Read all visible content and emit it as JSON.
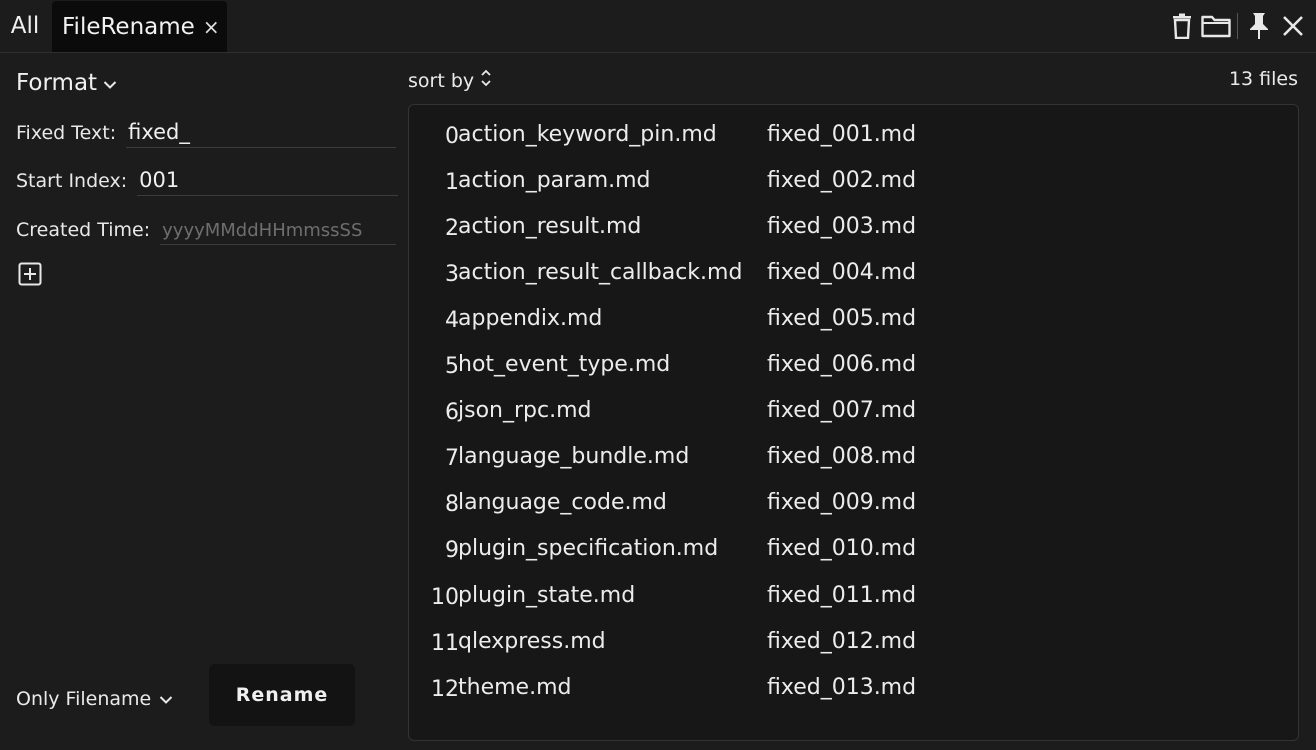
{
  "tabs": {
    "all_label": "All",
    "active_label": "FileRename",
    "close_glyph": "×"
  },
  "toolbar": {
    "icons": [
      "trash-icon",
      "folder-icon",
      "pin-icon",
      "close-icon"
    ]
  },
  "format": {
    "label": "Format",
    "fixed_text_label": "Fixed Text:",
    "fixed_text_value": "fixed_",
    "start_index_label": "Start Index:",
    "start_index_value": "001",
    "created_time_label": "Created Time:",
    "created_time_placeholder": "yyyyMMddHHmmssSS"
  },
  "footer": {
    "mode_label": "Only Filename",
    "rename_label": "Rename"
  },
  "list": {
    "sort_label": "sort by",
    "count_label": "13 files",
    "rows": [
      {
        "index": "0",
        "original": "action_keyword_pin.md",
        "renamed": "fixed_001.md"
      },
      {
        "index": "1",
        "original": "action_param.md",
        "renamed": "fixed_002.md"
      },
      {
        "index": "2",
        "original": "action_result.md",
        "renamed": "fixed_003.md"
      },
      {
        "index": "3",
        "original": "action_result_callback.md",
        "renamed": "fixed_004.md"
      },
      {
        "index": "4",
        "original": "appendix.md",
        "renamed": "fixed_005.md"
      },
      {
        "index": "5",
        "original": "hot_event_type.md",
        "renamed": "fixed_006.md"
      },
      {
        "index": "6",
        "original": "json_rpc.md",
        "renamed": "fixed_007.md"
      },
      {
        "index": "7",
        "original": "language_bundle.md",
        "renamed": "fixed_008.md"
      },
      {
        "index": "8",
        "original": "language_code.md",
        "renamed": "fixed_009.md"
      },
      {
        "index": "9",
        "original": "plugin_specification.md",
        "renamed": "fixed_010.md"
      },
      {
        "index": "10",
        "original": "plugin_state.md",
        "renamed": "fixed_011.md"
      },
      {
        "index": "11",
        "original": "qlexpress.md",
        "renamed": "fixed_012.md"
      },
      {
        "index": "12",
        "original": "theme.md",
        "renamed": "fixed_013.md"
      }
    ]
  },
  "colors": {
    "background": "#1c1c1c",
    "list_background": "#171717",
    "text": "#e6e6e6",
    "placeholder": "#6e6e6e"
  }
}
